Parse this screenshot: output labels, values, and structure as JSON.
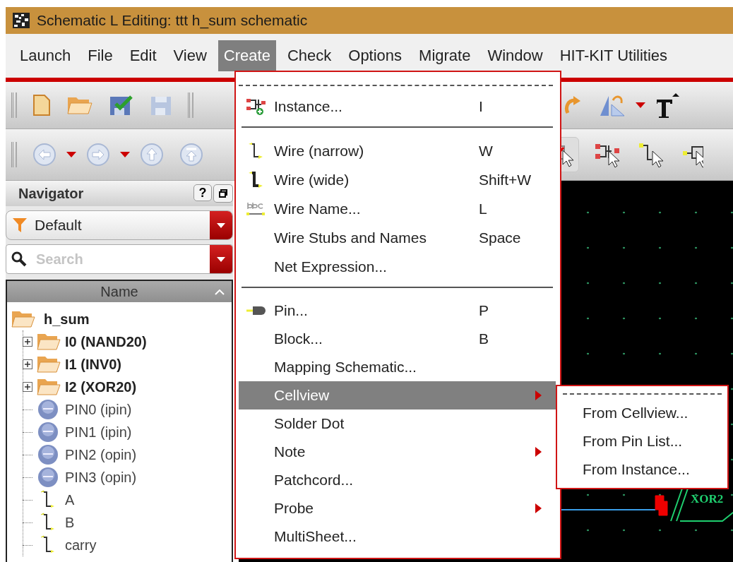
{
  "window": {
    "title": "Schematic L Editing: ttt h_sum schematic"
  },
  "menu_bar": [
    {
      "label": "Launch",
      "selected": false
    },
    {
      "label": "File",
      "selected": false
    },
    {
      "label": "Edit",
      "selected": false
    },
    {
      "label": "View",
      "selected": false
    },
    {
      "label": "Create",
      "selected": true
    },
    {
      "label": "Check",
      "selected": false
    },
    {
      "label": "Options",
      "selected": false
    },
    {
      "label": "Migrate",
      "selected": false
    },
    {
      "label": "Window",
      "selected": false
    },
    {
      "label": "HIT-KIT Utilities",
      "selected": false
    }
  ],
  "navigator": {
    "title": "Navigator",
    "help": "?",
    "filter": {
      "value": "Default"
    },
    "search": {
      "placeholder": "Search"
    },
    "column": "Name",
    "tree": [
      {
        "label": "h_sum",
        "kind": "folder",
        "children": [
          {
            "label": "I0 (NAND20)",
            "kind": "folder",
            "expanded": false
          },
          {
            "label": "I1 (INV0)",
            "kind": "folder",
            "expanded": false
          },
          {
            "label": "I2 (XOR20)",
            "kind": "folder",
            "expanded": false
          },
          {
            "label": "PIN0 (ipin)",
            "kind": "pin"
          },
          {
            "label": "PIN1 (ipin)",
            "kind": "pin"
          },
          {
            "label": "PIN2 (opin)",
            "kind": "pin"
          },
          {
            "label": "PIN3 (opin)",
            "kind": "pin"
          },
          {
            "label": "A",
            "kind": "wire"
          },
          {
            "label": "B",
            "kind": "wire"
          },
          {
            "label": "carry",
            "kind": "wire"
          }
        ]
      }
    ]
  },
  "create_menu": {
    "items": [
      {
        "kind": "instance",
        "label": "Instance...",
        "shortcut": "I",
        "selected": false,
        "submenu": false
      },
      {
        "kind": "separator"
      },
      {
        "kind": "wire",
        "label": "Wire (narrow)",
        "shortcut": "W",
        "selected": false,
        "submenu": false
      },
      {
        "kind": "wide-wire",
        "label": "Wire (wide)",
        "shortcut": "Shift+W",
        "selected": false,
        "submenu": false
      },
      {
        "kind": "wire-name",
        "label": "Wire Name...",
        "shortcut": "L",
        "selected": false,
        "submenu": false
      },
      {
        "kind": "item",
        "label": "Wire Stubs and Names",
        "shortcut": "Space",
        "selected": false,
        "submenu": false
      },
      {
        "kind": "item",
        "label": "Net Expression...",
        "selected": false,
        "submenu": false
      },
      {
        "kind": "separator"
      },
      {
        "kind": "pin",
        "label": "Pin...",
        "shortcut": "P",
        "selected": false,
        "submenu": false
      },
      {
        "kind": "item",
        "label": "Block...",
        "shortcut": "B",
        "selected": false,
        "submenu": false
      },
      {
        "kind": "item",
        "label": "Mapping Schematic...",
        "selected": false,
        "submenu": false
      },
      {
        "kind": "item",
        "label": "Cellview",
        "selected": true,
        "submenu": true
      },
      {
        "kind": "item",
        "label": "Solder Dot",
        "selected": false,
        "submenu": false
      },
      {
        "kind": "item",
        "label": "Note",
        "selected": false,
        "submenu": true
      },
      {
        "kind": "item",
        "label": "Patchcord...",
        "selected": false,
        "submenu": false
      },
      {
        "kind": "item",
        "label": "Probe",
        "selected": false,
        "submenu": true
      },
      {
        "kind": "item",
        "label": "MultiSheet...",
        "selected": false,
        "submenu": false
      }
    ]
  },
  "cellview_submenu": {
    "items": [
      {
        "label": "From Cellview...",
        "selected": false
      },
      {
        "label": "From Pin List...",
        "selected": false
      },
      {
        "label": "From Instance...",
        "selected": false
      }
    ]
  },
  "canvas": {
    "gate_label": "XOR2"
  }
}
